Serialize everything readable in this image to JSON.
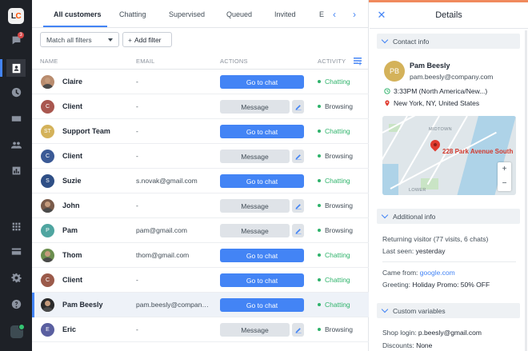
{
  "rail": {
    "logo": {
      "l": "L",
      "c": "C"
    },
    "badge": "3",
    "items": [
      "chats-icon",
      "customers-icon",
      "archives-icon",
      "agents-icon",
      "team-icon",
      "reports-icon",
      "apps-icon",
      "billing-icon",
      "settings-icon",
      "help-icon"
    ]
  },
  "tabs": {
    "all_customers": "All customers",
    "chatting": "Chatting",
    "supervised": "Supervised",
    "queued": "Queued",
    "invited": "Invited",
    "more": "E"
  },
  "filters": {
    "match": "Match all filters",
    "add": "Add filter",
    "add_plus": "+"
  },
  "table": {
    "headers": {
      "name": "NAME",
      "email": "EMAIL",
      "actions": "ACTIONS",
      "activity": "ACTIVITY"
    },
    "rows": [
      {
        "name": "Claire",
        "email": "-",
        "action": "Go to chat",
        "activity": "Chatting",
        "avatar_initial": "",
        "avatar_color": "#b98c6e"
      },
      {
        "name": "Client",
        "email": "-",
        "action": "Message",
        "activity": "Browsing",
        "avatar_initial": "C",
        "avatar_color": "#a9574f"
      },
      {
        "name": "Support Team",
        "email": "-",
        "action": "Go to chat",
        "activity": "Chatting",
        "avatar_initial": "ST",
        "avatar_color": "#d4b25a"
      },
      {
        "name": "Client",
        "email": "-",
        "action": "Message",
        "activity": "Browsing",
        "avatar_initial": "C",
        "avatar_color": "#3b5a96"
      },
      {
        "name": "Suzie",
        "email": "s.novak@gmail.com",
        "action": "Go to chat",
        "activity": "Chatting",
        "avatar_initial": "S",
        "avatar_color": "#2f4f86"
      },
      {
        "name": "John",
        "email": "-",
        "action": "Message",
        "activity": "Browsing",
        "avatar_initial": "",
        "avatar_color": "#7a5b4a"
      },
      {
        "name": "Pam",
        "email": "pam@gmail.com",
        "action": "Message",
        "activity": "Browsing",
        "avatar_initial": "P",
        "avatar_color": "#4fa5a0"
      },
      {
        "name": "Thom",
        "email": "thom@gmail.com",
        "action": "Go to chat",
        "activity": "Chatting",
        "avatar_initial": "",
        "avatar_color": "#6b8e4e"
      },
      {
        "name": "Client",
        "email": "-",
        "action": "Go to chat",
        "activity": "Chatting",
        "avatar_initial": "C",
        "avatar_color": "#9b5a4a"
      },
      {
        "name": "Pam Beesly",
        "email": "pam.beesly@company....",
        "action": "Go to chat",
        "activity": "Chatting",
        "avatar_initial": "",
        "avatar_color": "#2a2a2a"
      },
      {
        "name": "Eric",
        "email": "-",
        "action": "Message",
        "activity": "Browsing",
        "avatar_initial": "E",
        "avatar_color": "#5a5fa0"
      }
    ]
  },
  "details": {
    "title": "Details",
    "close": "✕",
    "contact_info": {
      "header": "Contact info",
      "initials": "PB",
      "name": "Pam Beesly",
      "email": "pam.beesly@company.com",
      "time": "3:33PM (North America/New...)",
      "location": "New York, NY, United States"
    },
    "map": {
      "label": "228 Park Avenue South",
      "zoom_in": "+",
      "zoom_out": "−",
      "district_1": "MIDTOWN",
      "district_2": "LOWER"
    },
    "additional_info": {
      "header": "Additional info",
      "returning": "Returning visitor (77 visits, 6 chats)",
      "last_seen_label": "Last seen:",
      "last_seen_value": "yesterday",
      "came_from_label": "Came from:",
      "came_from_value": "google.com",
      "greeting_label": "Greeting:",
      "greeting_value": "Holiday Promo: 50% OFF"
    },
    "custom_variables": {
      "header": "Custom variables",
      "shop_login_label": "Shop login:",
      "shop_login_value": "p.beesly@gmail.com",
      "discounts_label": "Discounts:",
      "discounts_value": "None"
    }
  },
  "colors": {
    "accent": "#4384f5",
    "chatting": "#2fb36b",
    "rail": "#1e2127",
    "brand_orange": "#ff5100"
  }
}
